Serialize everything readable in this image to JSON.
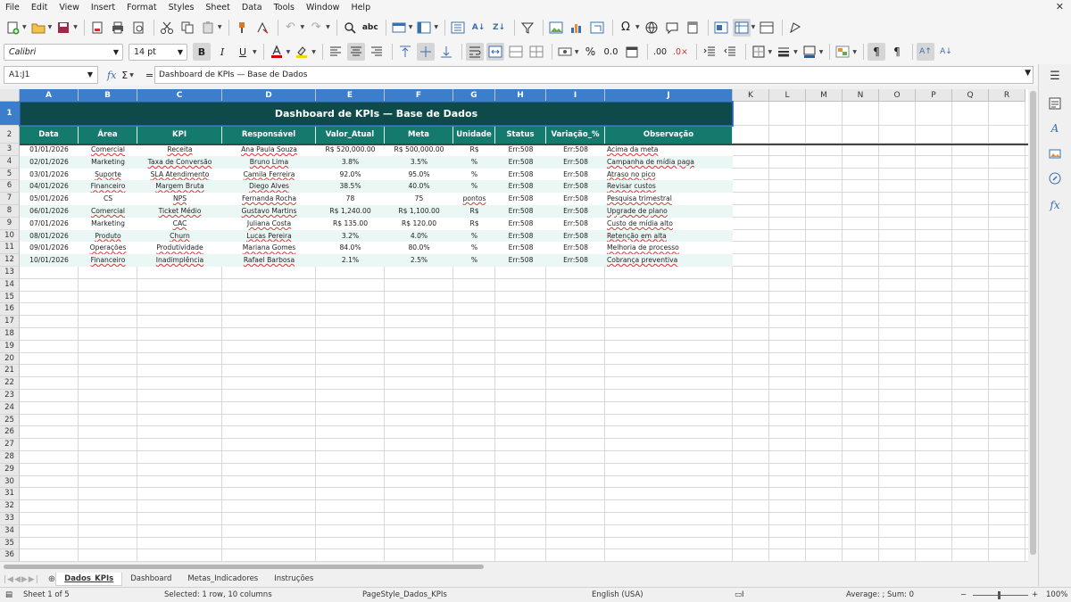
{
  "menu": [
    "File",
    "Edit",
    "View",
    "Insert",
    "Format",
    "Styles",
    "Sheet",
    "Data",
    "Tools",
    "Window",
    "Help"
  ],
  "window": {
    "close_icon": "close-icon"
  },
  "font": {
    "name": "Calibri",
    "size": "14 pt"
  },
  "namebox": "A1:J1",
  "formula": "Dashboard de KPIs — Base de Dados",
  "columns": [
    "A",
    "B",
    "C",
    "D",
    "E",
    "F",
    "G",
    "H",
    "I",
    "J",
    "K",
    "L",
    "M",
    "N",
    "O",
    "P",
    "Q",
    "R"
  ],
  "title": "Dashboard de KPIs — Base de Dados",
  "headers": [
    "Data",
    "Área",
    "KPI",
    "Responsável",
    "Valor_Atual",
    "Meta",
    "Unidade",
    "Status",
    "Variação_%",
    "Observação"
  ],
  "rows": [
    [
      "01/01/2026",
      "Comercial",
      "Receita",
      "Ana Paula Souza",
      "R$ 520,000.00",
      "R$ 500,000.00",
      "R$",
      "Err:508",
      "Err:508",
      "Acima da meta"
    ],
    [
      "02/01/2026",
      "Marketing",
      "Taxa de Conversão",
      "Bruno Lima",
      "3.8%",
      "3.5%",
      "%",
      "Err:508",
      "Err:508",
      "Campanha de mídia paga"
    ],
    [
      "03/01/2026",
      "Suporte",
      "SLA Atendimento",
      "Camila Ferreira",
      "92.0%",
      "95.0%",
      "%",
      "Err:508",
      "Err:508",
      "Atraso no pico"
    ],
    [
      "04/01/2026",
      "Financeiro",
      "Margem Bruta",
      "Diego Alves",
      "38.5%",
      "40.0%",
      "%",
      "Err:508",
      "Err:508",
      "Revisar custos"
    ],
    [
      "05/01/2026",
      "CS",
      "NPS",
      "Fernanda Rocha",
      "78",
      "75",
      "pontos",
      "Err:508",
      "Err:508",
      "Pesquisa trimestral"
    ],
    [
      "06/01/2026",
      "Comercial",
      "Ticket Médio",
      "Gustavo Martins",
      "R$ 1,240.00",
      "R$ 1,100.00",
      "R$",
      "Err:508",
      "Err:508",
      "Upgrade de plano"
    ],
    [
      "07/01/2026",
      "Marketing",
      "CAC",
      "Juliana Costa",
      "R$ 135.00",
      "R$ 120.00",
      "R$",
      "Err:508",
      "Err:508",
      "Custo de mídia alto"
    ],
    [
      "08/01/2026",
      "Produto",
      "Churn",
      "Lucas Pereira",
      "3.2%",
      "4.0%",
      "%",
      "Err:508",
      "Err:508",
      "Retenção em alta"
    ],
    [
      "09/01/2026",
      "Operações",
      "Produtividade",
      "Mariana Gomes",
      "84.0%",
      "80.0%",
      "%",
      "Err:508",
      "Err:508",
      "Melhoria de processo"
    ],
    [
      "10/01/2026",
      "Financeiro",
      "Inadimplência",
      "Rafael Barbosa",
      "2.1%",
      "2.5%",
      "%",
      "Err:508",
      "Err:508",
      "Cobrança preventiva"
    ]
  ],
  "row_numbers": [
    "1",
    "2",
    "3",
    "4",
    "5",
    "6",
    "7",
    "8",
    "9",
    "10",
    "11",
    "12",
    "13",
    "14",
    "15",
    "16",
    "17",
    "18",
    "19",
    "20",
    "21",
    "22",
    "23",
    "24",
    "25",
    "26",
    "27",
    "28",
    "29",
    "30",
    "31",
    "32",
    "33",
    "34",
    "35",
    "36"
  ],
  "tabs": [
    "Dados_KPIs",
    "Dashboard",
    "Metas_Indicadores",
    "Instruções"
  ],
  "active_tab": 0,
  "status": {
    "sheet": "Sheet 1 of 5",
    "selection": "Selected: 1 row, 10 columns",
    "pagestyle": "PageStyle_Dados_KPIs",
    "language": "English (USA)",
    "sum": "Average: ; Sum: 0",
    "zoom_minus": "−",
    "zoom_plus": "+",
    "zoom": "100%"
  },
  "colors": {
    "title_bg": "#0f4a4a",
    "header_bg": "#157a6e",
    "row_tint": "#eaf7f5",
    "selection": "#3c7ecb"
  }
}
